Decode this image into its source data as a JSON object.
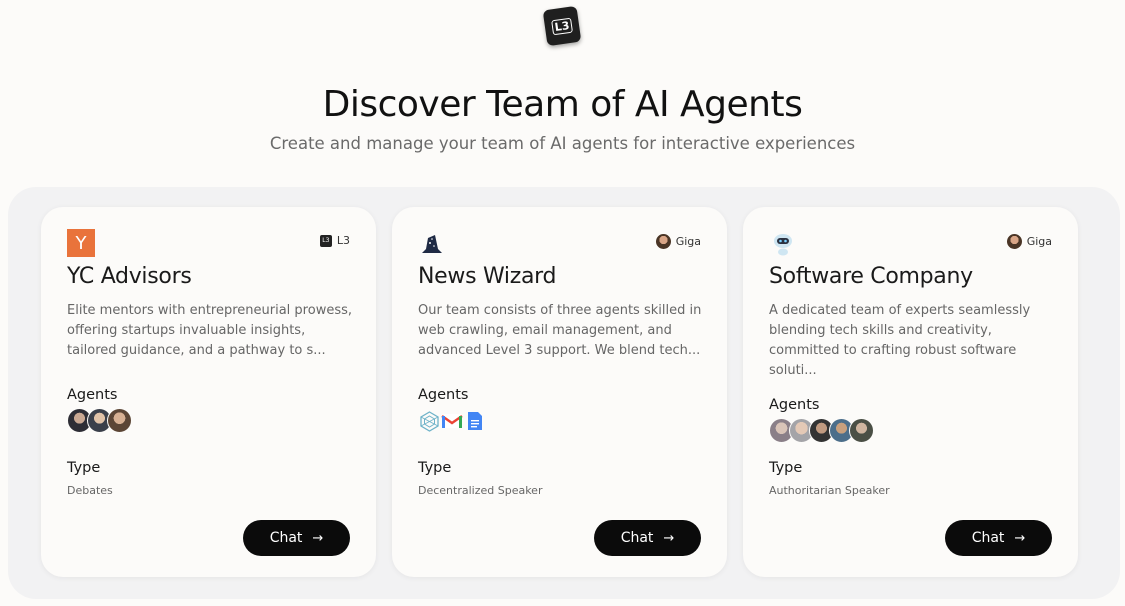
{
  "header": {
    "logo_text": "L3",
    "title": "Discover Team of AI Agents",
    "subtitle": "Create and manage your team of AI agents for interactive experiences"
  },
  "cards": [
    {
      "icon": "yc-logo-icon",
      "icon_text": "Y",
      "creator": "L3",
      "creator_icon": "l3-logo-icon",
      "title": "YC Advisors",
      "description": "Elite mentors with entrepreneurial prowess, offering startups invaluable insights, tailored guidance, and a pathway to s...",
      "agents_label": "Agents",
      "agents": [
        "agent-avatar-1",
        "agent-avatar-2",
        "agent-avatar-3"
      ],
      "type_label": "Type",
      "type": "Debates",
      "chat_label": "Chat"
    },
    {
      "icon": "wizard-hat-icon",
      "creator": "Giga",
      "creator_icon": "giga-avatar",
      "title": "News Wizard",
      "description": "Our team consists of three agents skilled in web crawling, email management, and advanced Level 3 support. We blend tech...",
      "agents_label": "Agents",
      "agents": [
        "web-crawler-icon",
        "gmail-icon",
        "google-docs-icon"
      ],
      "type_label": "Type",
      "type": "Decentralized Speaker",
      "chat_label": "Chat"
    },
    {
      "icon": "robot-icon",
      "creator": "Giga",
      "creator_icon": "giga-avatar",
      "title": "Software Company",
      "description": "A dedicated team of experts seamlessly blending tech skills and creativity, committed to crafting robust software soluti...",
      "agents_label": "Agents",
      "agents": [
        "agent-avatar-1",
        "agent-avatar-2",
        "agent-avatar-3",
        "agent-avatar-4",
        "agent-avatar-5"
      ],
      "type_label": "Type",
      "type": "Authoritarian Speaker",
      "chat_label": "Chat"
    }
  ],
  "colors": {
    "background": "#fcfbf9",
    "panel": "#f2f2f3",
    "button": "#0b0b0b",
    "yc_orange": "#e9733b"
  }
}
